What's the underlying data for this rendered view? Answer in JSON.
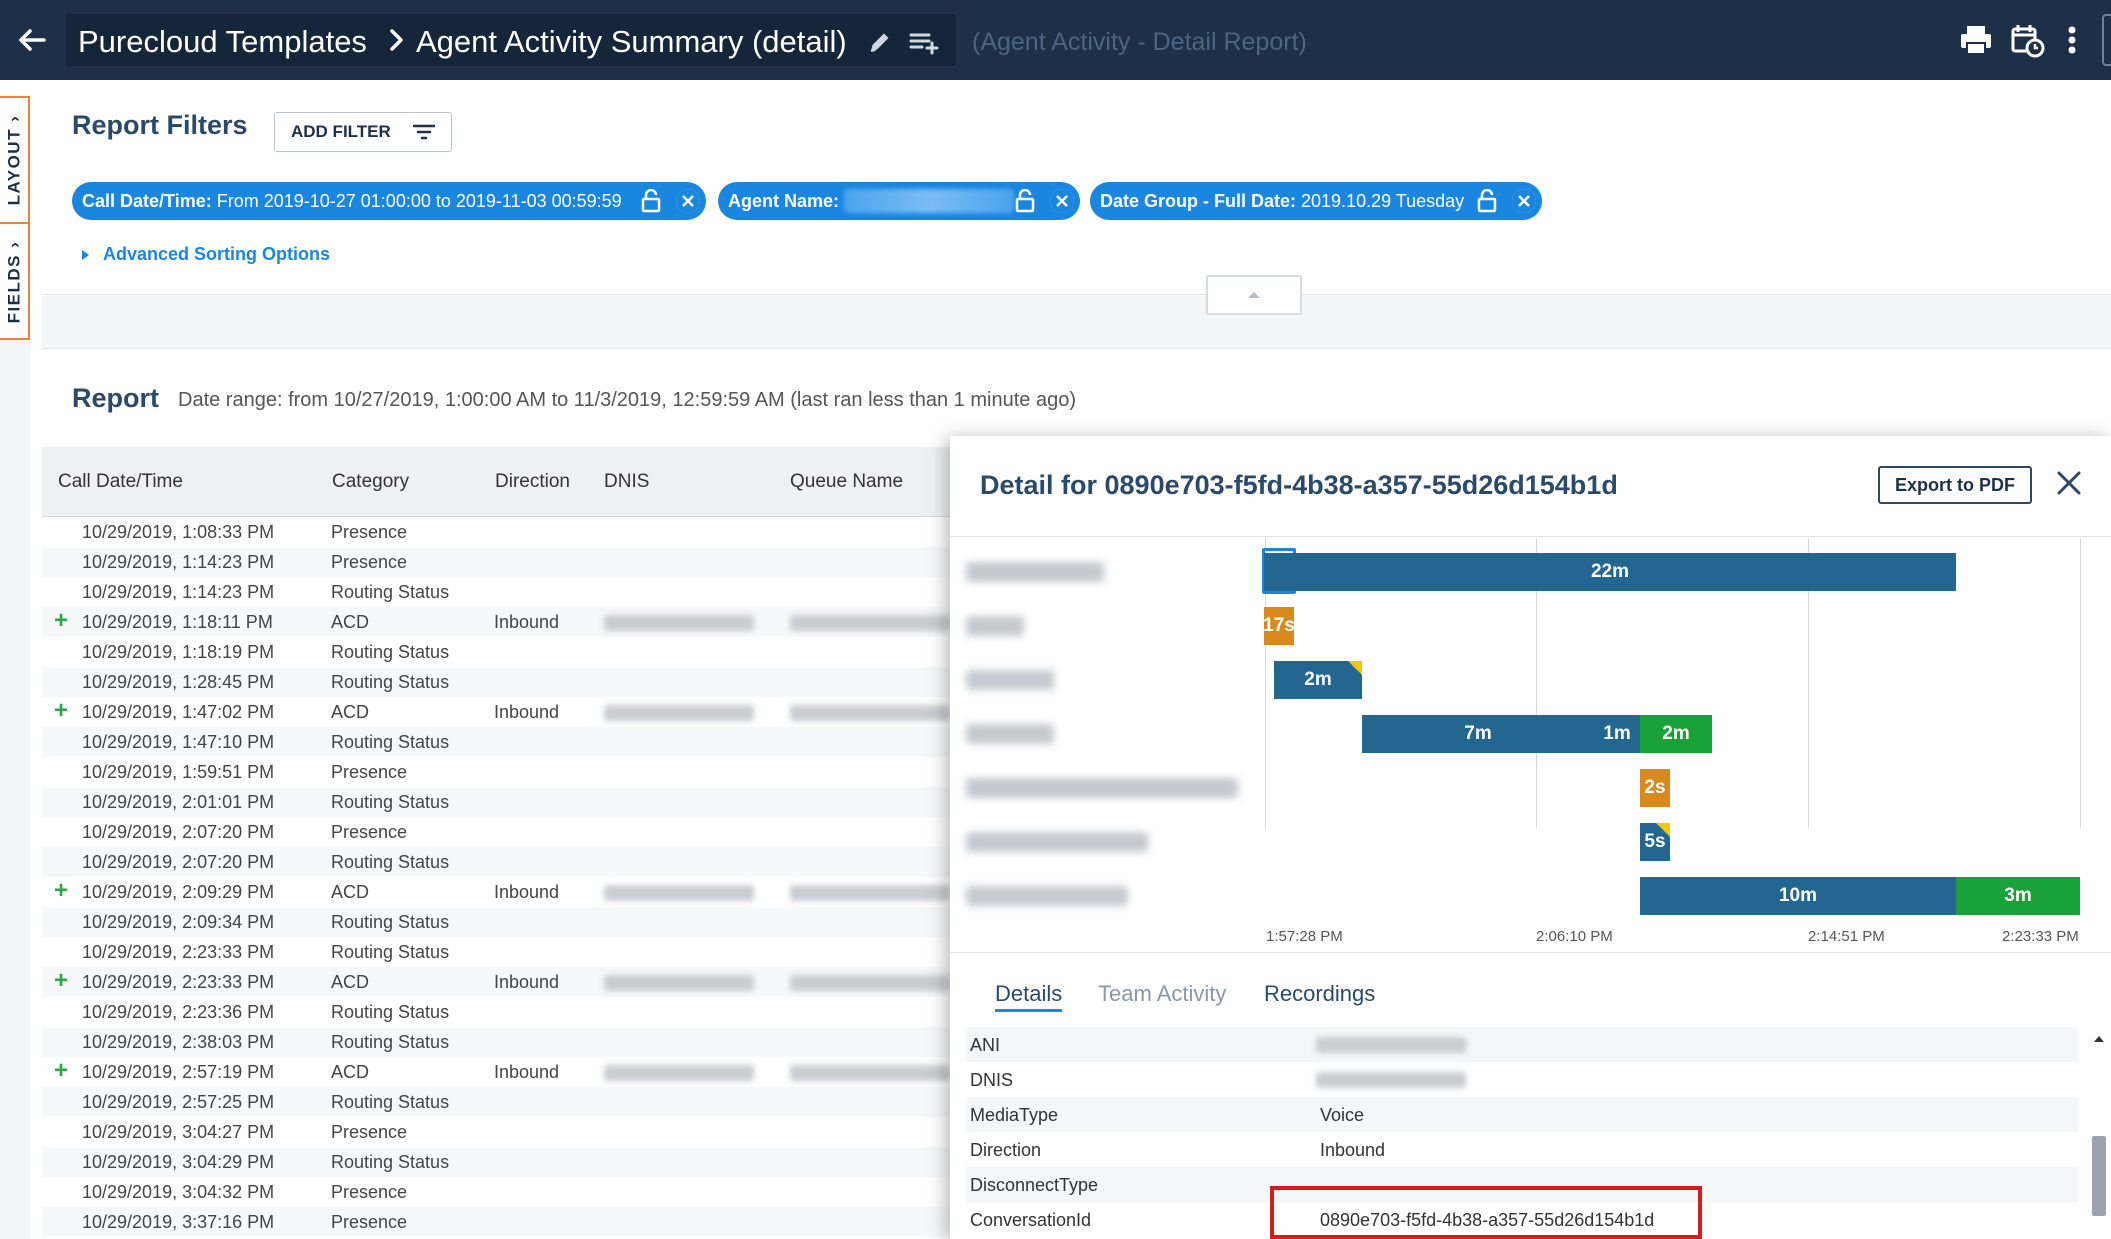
{
  "topbar": {
    "breadcrumb_root": "Purecloud Templates",
    "breadcrumb_current": "Agent Activity Summary (detail)",
    "subtitle": "(Agent Activity - Detail Report)"
  },
  "sidetabs": {
    "layout_label": "LAYOUT",
    "fields_label": "FIELDS"
  },
  "filters": {
    "title": "Report Filters",
    "add_filter_label": "ADD FILTER",
    "chips": [
      {
        "name": "Call Date/Time:",
        "value": "From 2019-10-27 01:00:00 to 2019-11-03 00:59:59"
      },
      {
        "name": "Agent Name:",
        "value": ""
      },
      {
        "name": "Date Group - Full Date:",
        "value": "2019.10.29 Tuesday"
      }
    ],
    "advanced_sorting_label": "Advanced Sorting Options"
  },
  "report": {
    "title": "Report",
    "date_range": "Date range: from 10/27/2019, 1:00:00 AM to 11/3/2019, 12:59:59 AM (last ran less than 1 minute ago)",
    "columns": [
      "Call Date/Time",
      "Category",
      "Direction",
      "DNIS",
      "Queue Name"
    ],
    "rows": [
      {
        "expand": "",
        "datetime": "10/29/2019, 1:08:33 PM",
        "category": "Presence",
        "direction": ""
      },
      {
        "expand": "",
        "datetime": "10/29/2019, 1:14:23 PM",
        "category": "Presence",
        "direction": ""
      },
      {
        "expand": "",
        "datetime": "10/29/2019, 1:14:23 PM",
        "category": "Routing Status",
        "direction": ""
      },
      {
        "expand": "+",
        "datetime": "10/29/2019, 1:18:11 PM",
        "category": "ACD",
        "direction": "Inbound"
      },
      {
        "expand": "",
        "datetime": "10/29/2019, 1:18:19 PM",
        "category": "Routing Status",
        "direction": ""
      },
      {
        "expand": "",
        "datetime": "10/29/2019, 1:28:45 PM",
        "category": "Routing Status",
        "direction": ""
      },
      {
        "expand": "+",
        "datetime": "10/29/2019, 1:47:02 PM",
        "category": "ACD",
        "direction": "Inbound"
      },
      {
        "expand": "",
        "datetime": "10/29/2019, 1:47:10 PM",
        "category": "Routing Status",
        "direction": ""
      },
      {
        "expand": "",
        "datetime": "10/29/2019, 1:59:51 PM",
        "category": "Presence",
        "direction": ""
      },
      {
        "expand": "",
        "datetime": "10/29/2019, 2:01:01 PM",
        "category": "Routing Status",
        "direction": ""
      },
      {
        "expand": "",
        "datetime": "10/29/2019, 2:07:20 PM",
        "category": "Presence",
        "direction": ""
      },
      {
        "expand": "",
        "datetime": "10/29/2019, 2:07:20 PM",
        "category": "Routing Status",
        "direction": ""
      },
      {
        "expand": "+",
        "datetime": "10/29/2019, 2:09:29 PM",
        "category": "ACD",
        "direction": "Inbound"
      },
      {
        "expand": "",
        "datetime": "10/29/2019, 2:09:34 PM",
        "category": "Routing Status",
        "direction": ""
      },
      {
        "expand": "",
        "datetime": "10/29/2019, 2:23:33 PM",
        "category": "Routing Status",
        "direction": ""
      },
      {
        "expand": "+",
        "datetime": "10/29/2019, 2:23:33 PM",
        "category": "ACD",
        "direction": "Inbound"
      },
      {
        "expand": "",
        "datetime": "10/29/2019, 2:23:36 PM",
        "category": "Routing Status",
        "direction": ""
      },
      {
        "expand": "",
        "datetime": "10/29/2019, 2:38:03 PM",
        "category": "Routing Status",
        "direction": ""
      },
      {
        "expand": "+",
        "datetime": "10/29/2019, 2:57:19 PM",
        "category": "ACD",
        "direction": "Inbound"
      },
      {
        "expand": "",
        "datetime": "10/29/2019, 2:57:25 PM",
        "category": "Routing Status",
        "direction": ""
      },
      {
        "expand": "",
        "datetime": "10/29/2019, 3:04:27 PM",
        "category": "Presence",
        "direction": ""
      },
      {
        "expand": "",
        "datetime": "10/29/2019, 3:04:29 PM",
        "category": "Routing Status",
        "direction": ""
      },
      {
        "expand": "",
        "datetime": "10/29/2019, 3:04:32 PM",
        "category": "Presence",
        "direction": ""
      },
      {
        "expand": "",
        "datetime": "10/29/2019, 3:37:16 PM",
        "category": "Presence",
        "direction": ""
      }
    ]
  },
  "detail": {
    "title": "Detail for 0890e703-f5fd-4b38-a357-55d26d154b1d",
    "export_label": "Export to PDF",
    "timeline": {
      "segments": [
        {
          "label": "22m",
          "color": "blue"
        },
        {
          "label": "17s",
          "color": "orange"
        },
        {
          "label": "2m",
          "color": "blue"
        },
        {
          "label": "7m",
          "color": "blue"
        },
        {
          "label": "1m",
          "color": "blue"
        },
        {
          "label": "2m",
          "color": "green"
        },
        {
          "label": "2s",
          "color": "orange"
        },
        {
          "label": "5s",
          "color": "blue"
        },
        {
          "label": "10m",
          "color": "blue"
        },
        {
          "label": "3m",
          "color": "green"
        }
      ],
      "ticks": [
        "1:57:28 PM",
        "2:06:10 PM",
        "2:14:51 PM",
        "2:23:33 PM"
      ]
    },
    "tabs": [
      "Details",
      "Team Activity",
      "Recordings"
    ],
    "fields": [
      {
        "key": "ANI",
        "value": ""
      },
      {
        "key": "DNIS",
        "value": ""
      },
      {
        "key": "MediaType",
        "value": "Voice"
      },
      {
        "key": "Direction",
        "value": "Inbound"
      },
      {
        "key": "DisconnectType",
        "value": ""
      },
      {
        "key": "ConversationId",
        "value": "0890e703-f5fd-4b38-a357-55d26d154b1d"
      }
    ]
  },
  "colors": {
    "topbar": "#1d3048",
    "accent": "#1a86e0",
    "bar_blue": "#23668f",
    "bar_orange": "#d98a1f",
    "bar_green": "#19a13a",
    "highlight": "#d81b1b"
  },
  "icons": [
    "back-arrow-icon",
    "chevron-right-icon",
    "pencil-icon",
    "playlist-add-icon",
    "print-icon",
    "schedule-icon",
    "more-vertical-icon",
    "filter-lines-icon",
    "lock-icon",
    "close-circle-icon",
    "caret-up-icon",
    "close-icon",
    "plus-icon"
  ]
}
